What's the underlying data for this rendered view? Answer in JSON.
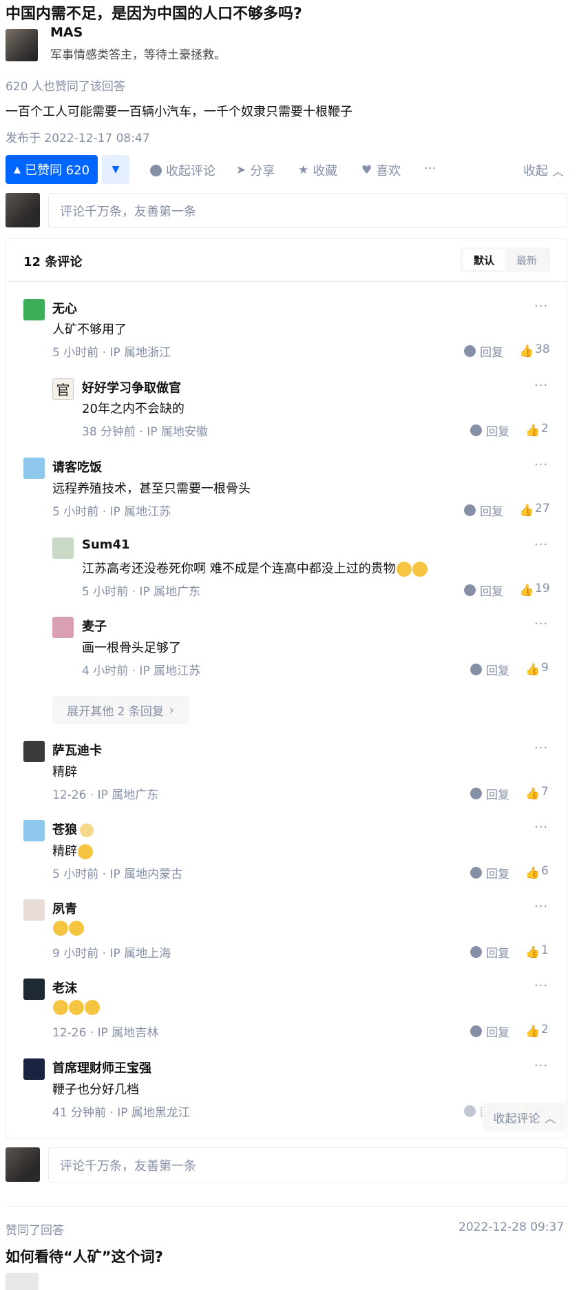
{
  "question": {
    "title": "中国内需不足，是因为中国的人口不够多吗?"
  },
  "author": {
    "name": "MAS",
    "bio": "军事情感类答主，等待土豪拯救。"
  },
  "answer": {
    "upvote_info": "620 人也赞同了该回答",
    "text": "一百个工人可能需要一百辆小汽车，一千个奴隶只需要十根鞭子",
    "publish_time": "发布于 2022-12-17 08:47"
  },
  "actions": {
    "vote_label": "已赞同 620",
    "comment_label": "收起评论",
    "share_label": "分享",
    "collect_label": "收藏",
    "like_label": "喜欢",
    "more_label": "···",
    "collapse_label": "收起"
  },
  "comment_box": {
    "placeholder": "评论千万条，友善第一条"
  },
  "comments_panel": {
    "count_label": "12 条评论",
    "sort_default": "默认",
    "sort_latest": "最新",
    "expand_label": "展开其他 2 条回复",
    "collapse_float": "收起评论",
    "reply_label": "回复",
    "more_label": "···"
  },
  "comments": [
    {
      "name": "无心",
      "text": "人矿不够用了",
      "meta": "5 小时前 · IP 属地浙江",
      "likes": "38"
    },
    {
      "name": "好好学习争取做官",
      "text": "20年之内不会缺的",
      "meta": "38 分钟前 · IP 属地安徽",
      "likes": "2"
    },
    {
      "name": "请客吃饭",
      "text": "远程养殖技术，甚至只需要一根骨头",
      "meta": "5 小时前 · IP 属地江苏",
      "likes": "27"
    },
    {
      "name": "Sum41",
      "text": "江苏高考还没卷死你啊 难不成是个连高中都没上过的贵物",
      "meta": "5 小时前 · IP 属地广东",
      "likes": "19"
    },
    {
      "name": "麦子",
      "text": "画一根骨头足够了",
      "meta": "4 小时前 · IP 属地江苏",
      "likes": "9"
    },
    {
      "name": "萨瓦迪卡",
      "text": "精辟",
      "meta": "12-26 · IP 属地广东",
      "likes": "7"
    },
    {
      "name": "苍狼",
      "text": "精辟",
      "meta": "5 小时前 · IP 属地内蒙古",
      "likes": "6"
    },
    {
      "name": "夙青",
      "text": "",
      "meta": "9 小时前 · IP 属地上海",
      "likes": "1"
    },
    {
      "name": "老沫",
      "text": "",
      "meta": "12-26 · IP 属地吉林",
      "likes": "2"
    },
    {
      "name": "首席理财师王宝强",
      "text": "鞭子也分好几档",
      "meta": "41 分钟前 · IP 属地黑龙江",
      "likes": "赞"
    }
  ],
  "next_item": {
    "activity": "赞同了回答",
    "time": "2022-12-28 09:37",
    "title": "如何看待“人矿”这个词?"
  },
  "colors": {
    "accent": "#0066ff",
    "meta": "#8590a6"
  }
}
